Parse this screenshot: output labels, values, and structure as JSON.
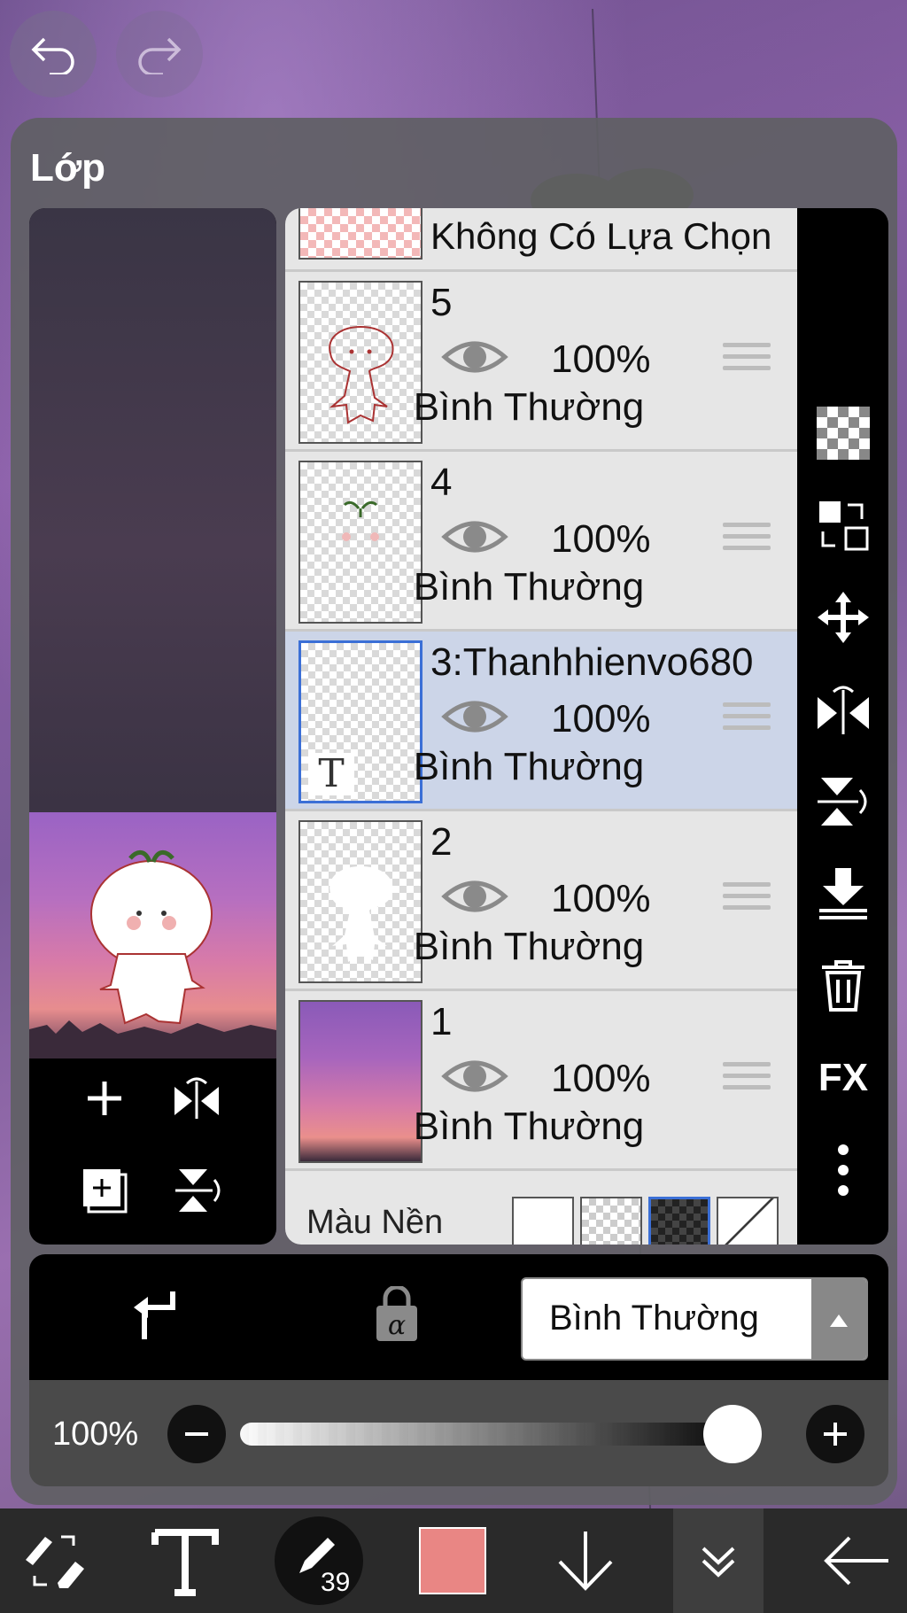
{
  "panel": {
    "title": "Lớp"
  },
  "layers": {
    "no_selection_label": "Không Có Lựa Chọn",
    "items": [
      {
        "name": "5",
        "opacity": "100%",
        "blend": "Bình Thường",
        "visible_icon": "eye-icon"
      },
      {
        "name": "4",
        "opacity": "100%",
        "blend": "Bình Thường",
        "visible_icon": "eye-icon"
      },
      {
        "name": "3:Thanhhienvo680",
        "opacity": "100%",
        "blend": "Bình Thường",
        "visible_icon": "eye-icon",
        "selected": true,
        "thumb_text": "T"
      },
      {
        "name": "2",
        "opacity": "100%",
        "blend": "Bình Thường",
        "visible_icon": "eye-icon"
      },
      {
        "name": "1",
        "opacity": "100%",
        "blend": "Bình Thường",
        "visible_icon": "eye-icon"
      }
    ],
    "background_color_label": "Màu Nền"
  },
  "controls": {
    "blend_mode": "Bình Thường",
    "opacity_label": "100%",
    "opacity_value": 1.0
  },
  "colors": {
    "current_color": "#e98684",
    "selected_outline": "#3b6fd6"
  },
  "toolbar": {
    "brush_size": "39"
  },
  "sidebar": {
    "fx_label": "FX"
  }
}
